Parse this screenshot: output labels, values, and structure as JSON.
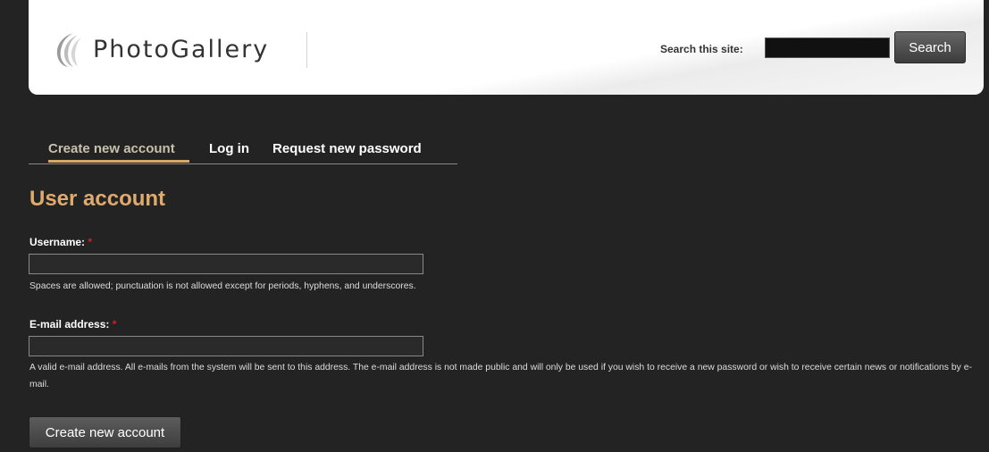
{
  "header": {
    "logo_text": "PhotoGallery",
    "search_label": "Search this site:",
    "search_value": "",
    "search_button": "Search"
  },
  "tabs": [
    {
      "label": "Create new account",
      "active": true
    },
    {
      "label": "Log in",
      "active": false
    },
    {
      "label": "Request new password",
      "active": false
    }
  ],
  "page_title": "User account",
  "form": {
    "required_marker": "*",
    "username": {
      "label": "Username:",
      "value": "",
      "description": "Spaces are allowed; punctuation is not allowed except for periods, hyphens, and underscores."
    },
    "email": {
      "label": "E-mail address:",
      "value": "",
      "description": "A valid e-mail address. All e-mails from the system will be sent to this address. The e-mail address is not made public and will only be used if you wish to receive a new password or wish to receive certain news or notifications by e-mail."
    },
    "submit_label": "Create new account"
  },
  "colors": {
    "page_background": "#232323",
    "accent": "#e0aa6c",
    "tab_underline": "#d8a868",
    "required": "#cc2222"
  }
}
